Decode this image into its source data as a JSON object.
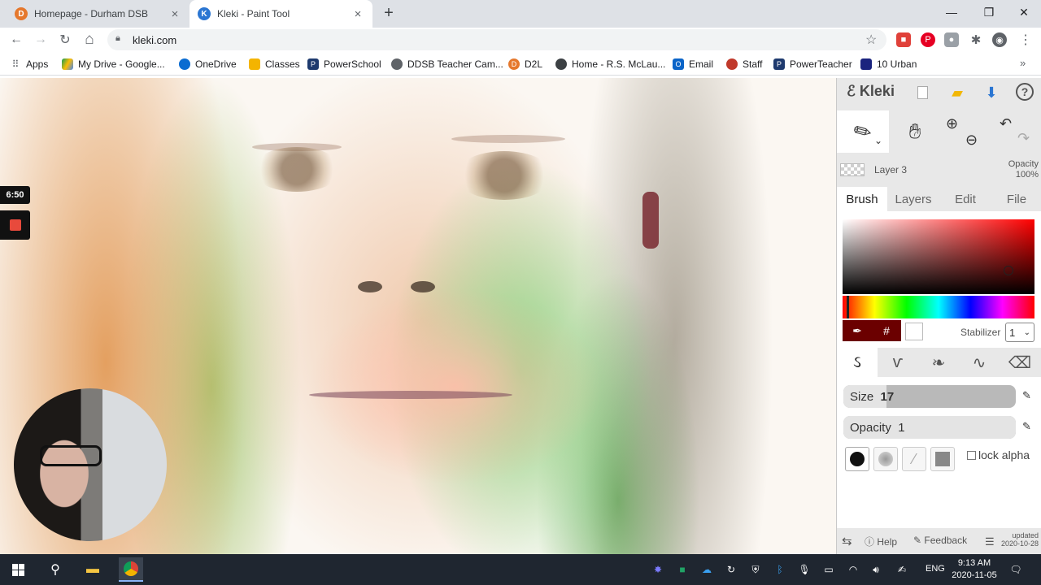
{
  "colors": {
    "tabstrip": "#dee1e6",
    "kleki_panel": "#e8e8e8",
    "taskbar": "#1f2630",
    "primary_color": "#6b0000",
    "secondary_color": "#ffffff",
    "record_red": "#e84a3c",
    "kleki_accent": "#2b76d2"
  },
  "browser": {
    "tabs": [
      {
        "title": "Homepage - Durham DSB",
        "favicon": "d2l-orange-icon",
        "close": "×"
      },
      {
        "title": "Kleki - Paint Tool",
        "favicon": "kleki-icon",
        "close": "×"
      }
    ],
    "new_tab": "+",
    "window_controls": {
      "minimize": "—",
      "maximize": "❐",
      "close": "✕"
    },
    "nav": {
      "back": "←",
      "forward": "→",
      "reload": "↻",
      "home": "⌂"
    },
    "url": "kleki.com",
    "bookmark_star": "☆",
    "bookmarks": [
      {
        "label": "Apps",
        "icon": "apps-grid-icon"
      },
      {
        "label": "My Drive - Google...",
        "icon": "google-drive-icon"
      },
      {
        "label": "OneDrive",
        "icon": "onedrive-icon"
      },
      {
        "label": "Classes",
        "icon": "classroom-icon"
      },
      {
        "label": "PowerSchool",
        "icon": "powerschool-icon"
      },
      {
        "label": "DDSB Teacher Cam...",
        "icon": "teacher-cam-icon"
      },
      {
        "label": "D2L",
        "icon": "d2l-icon"
      },
      {
        "label": "Home - R.S. McLau...",
        "icon": "school-home-icon"
      },
      {
        "label": "Email",
        "icon": "outlook-icon"
      },
      {
        "label": "Staff",
        "icon": "staff-icon"
      },
      {
        "label": "PowerTeacher",
        "icon": "powerteacher-icon"
      },
      {
        "label": "10 Urban",
        "icon": "urban-icon"
      }
    ],
    "bookmarks_more": "»"
  },
  "recording": {
    "timer": "6:50"
  },
  "kleki": {
    "logo": "Kleki",
    "header_icons": {
      "new": "new-file-icon",
      "open": "open-folder-icon",
      "save": "download-icon",
      "help": "?"
    },
    "layer": {
      "name": "Layer 3",
      "opacity_label": "Opacity",
      "opacity_value": "100%"
    },
    "tabs": [
      "Brush",
      "Layers",
      "Edit",
      "File"
    ],
    "active_tab": "Brush",
    "picker": {
      "eyedropper": "eyedropper-icon",
      "hex": "#"
    },
    "stabilizer": {
      "label": "Stabilizer",
      "value": "1"
    },
    "size": {
      "label": "Size",
      "value": "17",
      "fraction": 0.25
    },
    "opacity": {
      "label": "Opacity",
      "value": "1",
      "fraction": 1.0
    },
    "lock_alpha": "lock alpha",
    "footer": {
      "help": "Help",
      "feedback": "Feedback",
      "updated_label": "updated",
      "updated_date": "2020-10-28"
    }
  },
  "taskbar": {
    "language": "ENG",
    "time": "9:13 AM",
    "date": "2020-11-05"
  }
}
